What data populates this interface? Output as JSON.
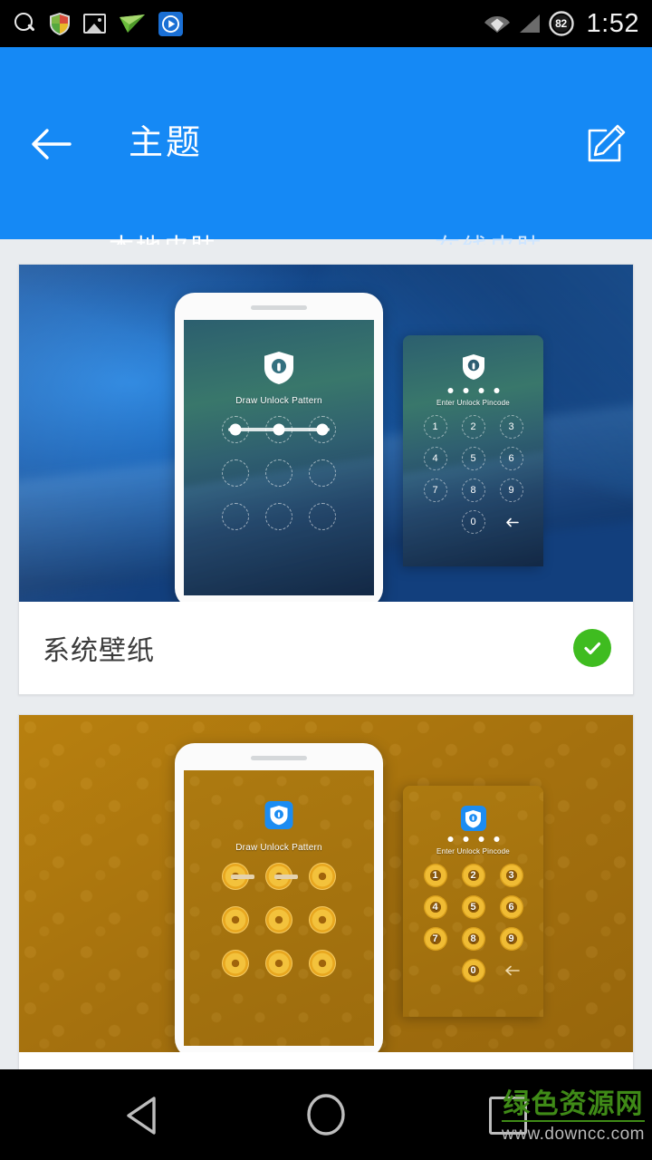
{
  "status_bar": {
    "time": "1:52",
    "battery_level": "82",
    "left_icons": [
      "search-icon",
      "security-shield-icon",
      "gallery-image-icon",
      "paper-plane-icon",
      "media-player-icon"
    ],
    "right_icons": [
      "wifi-icon",
      "signal-icon",
      "battery-icon"
    ]
  },
  "app_bar": {
    "title": "主题",
    "back_icon": "back-arrow-icon",
    "edit_icon": "edit-pencil-icon"
  },
  "tabs": [
    {
      "label": "本地皮肤",
      "active": true
    },
    {
      "label": "在线皮肤",
      "active": false
    }
  ],
  "themes": [
    {
      "title": "系统壁纸",
      "selected": true,
      "selected_icon": "green-check-icon",
      "preview": {
        "style": "blue-water-wallpaper",
        "pattern_text": "Draw Unlock Pattern",
        "pincode_text": "Enter Unlock Pincode",
        "keypad": [
          "1",
          "2",
          "3",
          "4",
          "5",
          "6",
          "7",
          "8",
          "9",
          "0"
        ],
        "backspace_icon": "backspace-icon",
        "shield_icon": "shield-lock-icon",
        "pin_dot_count": 4
      }
    },
    {
      "title": "",
      "selected": false,
      "preview": {
        "style": "golden-ornament-wallpaper",
        "pattern_text": "Draw Unlock Pattern",
        "pincode_text": "Enter Unlock Pincode",
        "keypad": [
          "1",
          "2",
          "3",
          "4",
          "5",
          "6",
          "7",
          "8",
          "9",
          "0"
        ],
        "backspace_icon": "backspace-icon",
        "shield_icon": "shield-lock-icon",
        "pin_dot_count": 4
      }
    }
  ],
  "nav_bar": {
    "back_icon": "nav-back-triangle-icon",
    "home_icon": "nav-home-circle-icon",
    "recents_icon": "nav-recents-square-icon"
  },
  "watermark": {
    "site_name": "绿色资源网",
    "url": "www.downcc.com"
  },
  "colors": {
    "app_bar": "#1589f5",
    "tab_indicator": "#24c6f0",
    "selected_check": "#3fbc20",
    "page_background": "#e9ecef"
  }
}
